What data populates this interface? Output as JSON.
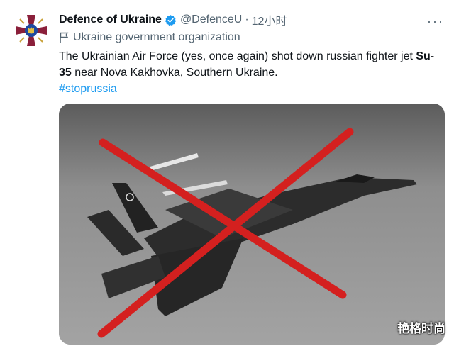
{
  "author": {
    "name": "Defence of Ukraine",
    "handle": "@DefenceU",
    "separator": "·",
    "time": "12小时",
    "org_label": "Ukraine government organization",
    "more_icon": "more-icon",
    "verified_color": "#1d9bf0"
  },
  "tweet": {
    "text_part1": "The Ukrainian Air Force (yes, once again) shot down russian fighter jet ",
    "text_bold": "Su-35",
    "text_part2": " near Nova Kakhovka, Southern Ukraine.",
    "hashtag": "#stoprussia",
    "hashtag_color": "#1d9bf0"
  },
  "media": {
    "subject": "fighter-jet-photo",
    "overlay": "red-x-cross",
    "overlay_color": "#d4201f"
  },
  "watermark": "艳格时尚"
}
